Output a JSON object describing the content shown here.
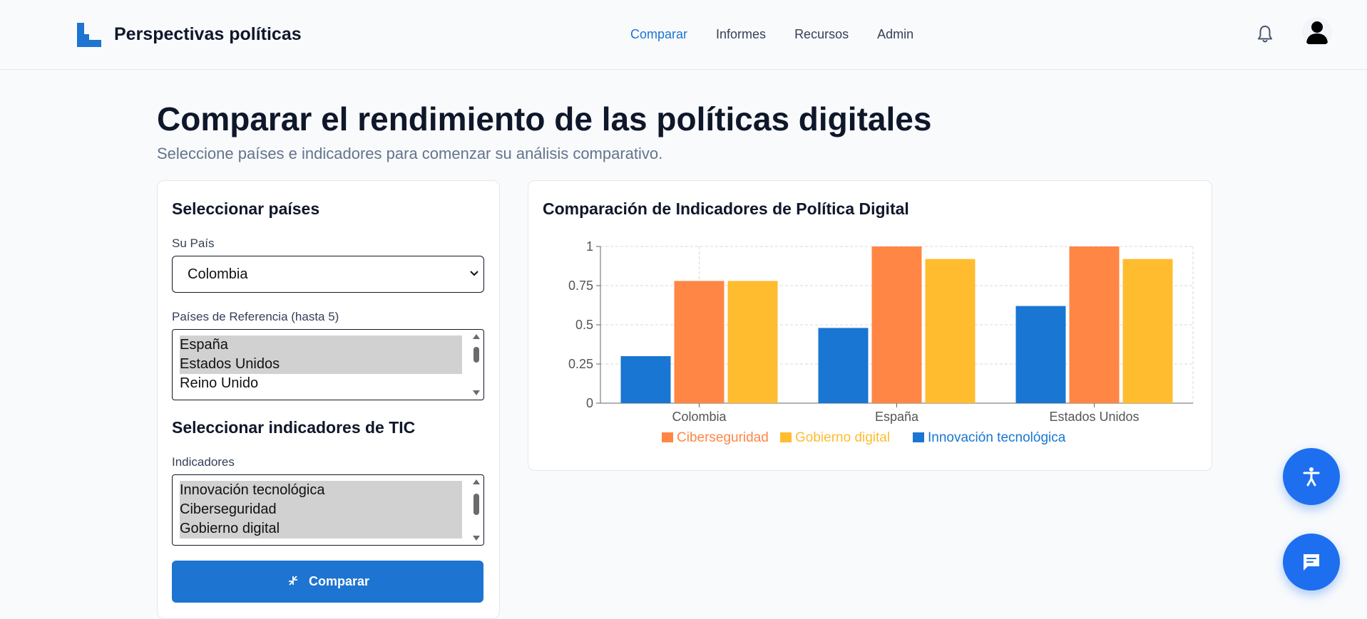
{
  "brand": {
    "name": "Perspectivas políticas"
  },
  "nav": {
    "items": [
      "Comparar",
      "Informes",
      "Recursos",
      "Admin"
    ],
    "active": "Comparar"
  },
  "page": {
    "title": "Comparar el rendimiento de las políticas digitales",
    "subtitle": "Seleccione países e indicadores para comenzar su análisis comparativo."
  },
  "form": {
    "countries_heading": "Seleccionar países",
    "your_country_label": "Su País",
    "your_country_value": "Colombia",
    "reference_label": "Países de Referencia (hasta 5)",
    "reference_options": [
      {
        "label": "España",
        "selected": true
      },
      {
        "label": "Estados Unidos",
        "selected": true
      },
      {
        "label": "Reino Unido",
        "selected": false
      }
    ],
    "indicators_heading": "Seleccionar indicadores de TIC",
    "indicators_label": "Indicadores",
    "indicator_options": [
      {
        "label": "Innovación tecnológica",
        "selected": true
      },
      {
        "label": "Ciberseguridad",
        "selected": true
      },
      {
        "label": "Gobierno digital",
        "selected": true
      }
    ],
    "compare_button": "Comparar"
  },
  "colors": {
    "accent": "#1d74d1",
    "innovacion": "#1976d2",
    "ciberseguridad": "#ff8644",
    "gobierno": "#ffbc2e"
  },
  "chart_data": {
    "type": "bar",
    "title": "Comparación de Indicadores de Política Digital",
    "categories": [
      "Colombia",
      "España",
      "Estados Unidos"
    ],
    "series": [
      {
        "name": "Innovación tecnológica",
        "values": [
          0.3,
          0.48,
          0.62
        ]
      },
      {
        "name": "Ciberseguridad",
        "values": [
          0.78,
          1.0,
          1.0
        ]
      },
      {
        "name": "Gobierno digital",
        "values": [
          0.78,
          0.92,
          0.92
        ]
      }
    ],
    "legend_order": [
      "Ciberseguridad",
      "Gobierno digital",
      "Innovación tecnológica"
    ],
    "ylim": [
      0,
      1
    ],
    "yticks": [
      "0",
      "0.25",
      "0.5",
      "0.75",
      "1"
    ],
    "grid": true,
    "legend_position": "bottom"
  }
}
